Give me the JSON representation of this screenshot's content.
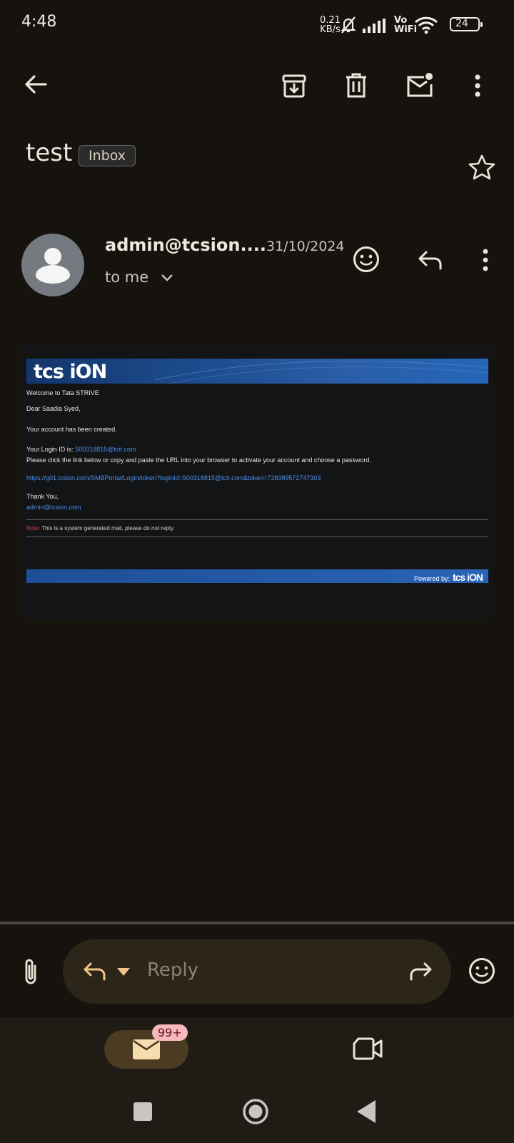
{
  "status_bar": {
    "time": "4:48",
    "net_speed_value": "0.21",
    "net_speed_unit": "KB/s",
    "vo": "Vo",
    "wifi": "WiFi",
    "battery": "24"
  },
  "toolbar": {
    "back_icon": "arrow-left-icon",
    "archive_icon": "archive-icon",
    "delete_icon": "trash-icon",
    "mark_unread_icon": "mail-unread-icon",
    "more_icon": "more-vertical-icon"
  },
  "message": {
    "subject": "test",
    "label": "Inbox",
    "sender": "admin@tcsion....",
    "date": "31/10/2024",
    "recipient": "to me"
  },
  "email_body": {
    "logo": "tcs iON",
    "welcome": "Welcome to Tata STRIVE",
    "greeting": "Dear  Saadia Syed,",
    "created": "Your account has been created.",
    "login_label": "Your Login ID is: ",
    "login_id": "500318815@tcit.com",
    "instruction": "Please click the link below or copy and paste the URL into your browser to activate your account and choose a password.",
    "url": "https://g01.tcsion.com/SMBPortal/Login/token?loginId=500318815@tcit.com&token=738389572747303",
    "thanks": "Thank You,",
    "signature_email": "admin@tcsion.com",
    "note_label": "Note:",
    "note_text": " This is a system generated mail, please do not reply.",
    "powered_by": "Powered by:",
    "footer_logo": "tcs iON"
  },
  "reply_bar": {
    "reply_placeholder": "Reply"
  },
  "bottom_nav": {
    "mail_badge": "99+"
  },
  "colors": {
    "background": "#16130f",
    "accent": "#f2c585",
    "badge": "#f7b8bd",
    "link": "#4d8fe8"
  }
}
